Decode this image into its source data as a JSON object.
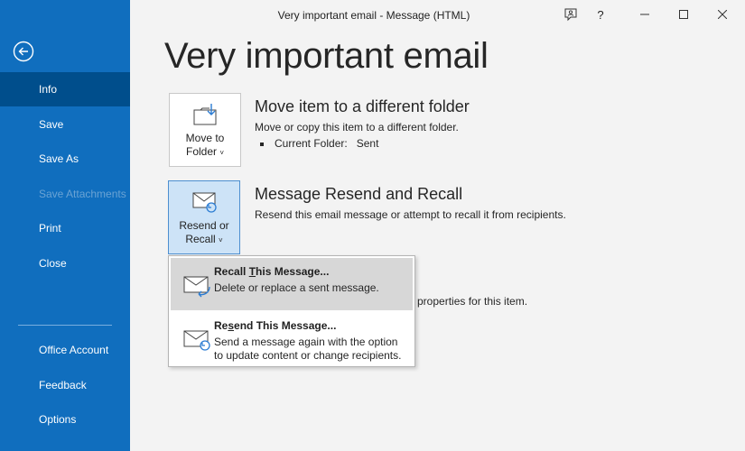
{
  "window": {
    "title": "Very important email  -  Message (HTML)",
    "help": "?"
  },
  "sidebar": {
    "items": [
      {
        "label": "Info"
      },
      {
        "label": "Save"
      },
      {
        "label": "Save As"
      },
      {
        "label": "Save Attachments"
      },
      {
        "label": "Print"
      },
      {
        "label": "Close"
      },
      {
        "label": "Office Account"
      },
      {
        "label": "Feedback"
      },
      {
        "label": "Options"
      }
    ]
  },
  "main": {
    "title": "Very important email",
    "move": {
      "tile_line1": "Move to",
      "tile_line2": "Folder",
      "title": "Move item to a different folder",
      "desc": "Move or copy this item to a different folder.",
      "folder_label": "Current Folder:",
      "folder_value": "Sent"
    },
    "resend": {
      "tile_line1": "Resend or",
      "tile_line2": "Recall",
      "title": "Message Resend and Recall",
      "desc": "Resend this email message or attempt to recall it from recipients."
    },
    "properties_partial": "properties for this item."
  },
  "dropdown": {
    "recall": {
      "title_pre": "Recall ",
      "title_u": "T",
      "title_post": "his Message...",
      "desc": "Delete or replace a sent message."
    },
    "resend": {
      "title_pre": "Re",
      "title_u": "s",
      "title_post": "end This Message...",
      "desc_line1": "Send a message again with the option",
      "desc_line2": "to update content or change recipients."
    }
  },
  "icons": {
    "back": "back-arrow-icon",
    "feedback": "feedback-icon",
    "move": "move-folder-icon",
    "resend": "envelope-resend-icon",
    "recall": "envelope-recall-icon"
  },
  "colors": {
    "sidebar": "#106ebe",
    "sidebar_active": "#004e8c",
    "accent_icon": "#2b7cd3"
  }
}
